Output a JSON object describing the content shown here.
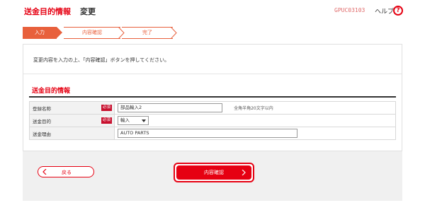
{
  "header": {
    "title": "送金目的情報",
    "subtitle": "変更",
    "screen_code": "GPUC03103",
    "help_label": "ヘルプ",
    "help_icon": "?"
  },
  "steps": [
    {
      "label": "入力",
      "state": "active"
    },
    {
      "label": "内容確認",
      "state": "pending"
    },
    {
      "label": "完了",
      "state": "pending"
    }
  ],
  "instruction": "変更内容を入力の上、「内容確認」ボタンを押してください。",
  "section": {
    "title": "送金目的情報"
  },
  "form": {
    "rows": [
      {
        "label": "登録名称",
        "required_badge": "必須",
        "value": "部品輸入2",
        "hint": "全角半角20文字以内"
      },
      {
        "label": "送金目的",
        "required_badge": "必須",
        "value": "輸入"
      },
      {
        "label": "送金理由",
        "value": "AUTO PARTS"
      }
    ]
  },
  "buttons": {
    "back_label": "戻る",
    "confirm_label": "内容確認"
  },
  "colors": {
    "accent": "#e60012",
    "step_active": "#e8603c",
    "label_bg": "#f2f2f2"
  }
}
